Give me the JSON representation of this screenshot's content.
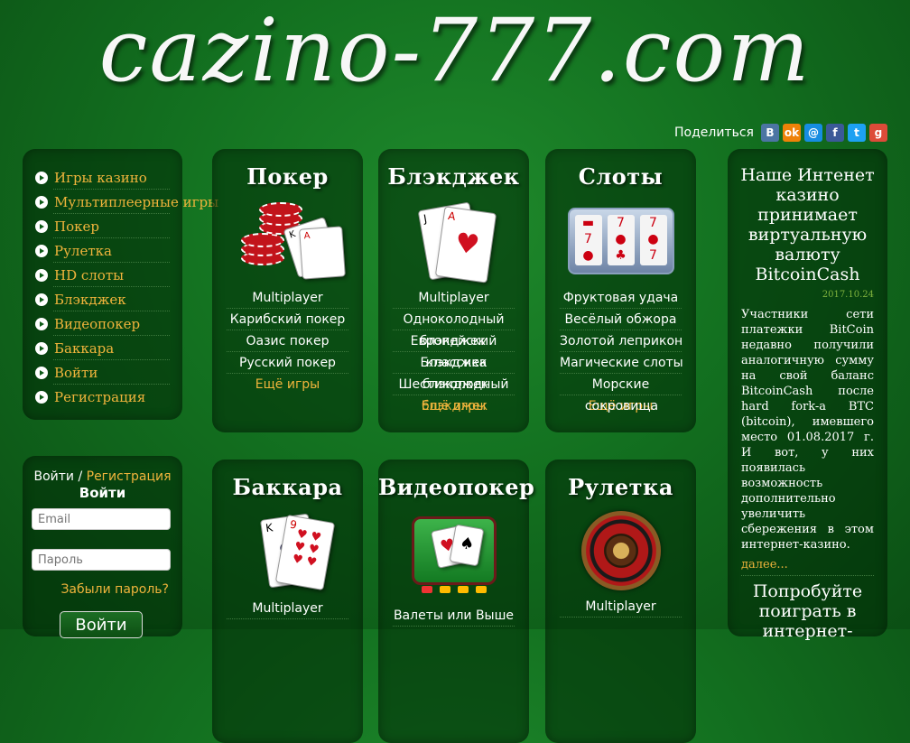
{
  "site": {
    "logo": "cazino-777.com"
  },
  "share": {
    "label": "Поделиться",
    "icons": [
      {
        "name": "vk-icon",
        "glyph": "B",
        "color": "#4c75a3"
      },
      {
        "name": "odnoklassniki-icon",
        "glyph": "ok",
        "color": "#ee8208"
      },
      {
        "name": "mailru-icon",
        "glyph": "@",
        "color": "#168de2"
      },
      {
        "name": "facebook-icon",
        "glyph": "f",
        "color": "#3b5998"
      },
      {
        "name": "twitter-icon",
        "glyph": "t",
        "color": "#1da1f2"
      },
      {
        "name": "googleplus-icon",
        "glyph": "g",
        "color": "#dd4b39"
      }
    ]
  },
  "menu": {
    "items": [
      {
        "label": "Игры казино"
      },
      {
        "label": "Мультиплеерные игры"
      },
      {
        "label": "Покер"
      },
      {
        "label": "Рулетка"
      },
      {
        "label": "HD слоты"
      },
      {
        "label": "Блэкджек"
      },
      {
        "label": "Видеопокер"
      },
      {
        "label": "Баккара"
      },
      {
        "label": "Войти"
      },
      {
        "label": "Регистрация"
      }
    ]
  },
  "login": {
    "top_login": "Войти",
    "separator": " / ",
    "top_register": "Регистрация",
    "title": "Войти",
    "email_placeholder": "Email",
    "password_placeholder": "Пароль",
    "forgot": "Забыли пароль?",
    "button": "Войти"
  },
  "games": {
    "poker": {
      "title": "Покер",
      "items": [
        "Multiplayer",
        "Карибский покер",
        "Оазис покер",
        "Русский покер"
      ],
      "more": "Ещё игры"
    },
    "blackjack": {
      "title": "Блэкджек",
      "items": [
        "Multiplayer",
        "Одноколодный"
      ],
      "overlap1a": "Европейский",
      "overlap1b": "блэкджек",
      "overlap2a": "Блэкджек",
      "overlap2b": "классика",
      "overlap3a": "Шестиколодный",
      "overlap3b": "блэкджек",
      "more": "Ещё игры"
    },
    "slots": {
      "title": "Слоты",
      "items": [
        "Фруктовая удача",
        "Весёлый обжора",
        "Золотой леприкон",
        "Магические слоты",
        "Морские"
      ],
      "overlap_a": "Ещё игры",
      "overlap_b": "сокровища"
    },
    "baccarat": {
      "title": "Баккара",
      "items": [
        "Multiplayer"
      ]
    },
    "videopoker": {
      "title": "Видеопокер",
      "items": [
        "Валеты или Выше"
      ]
    },
    "roulette": {
      "title": "Рулетка",
      "items": [
        "Multiplayer"
      ]
    }
  },
  "news": {
    "title": "Наше Интенет казино принимает виртуальную валюту BitcoinCash",
    "date": "2017.10.24",
    "text": "Участники сети платежки BitCoin недавно получили аналогичную сумму на свой баланс BitcoinCash после hard fork-a BTC (bitcoin), имевшего место 01.08.2017 г. И вот, у них появилась возможность дополнительно увеличить сбережения в этом интернет-казино.",
    "more": "далее...",
    "title2": "Попробуйте поиграть в интернет-"
  }
}
